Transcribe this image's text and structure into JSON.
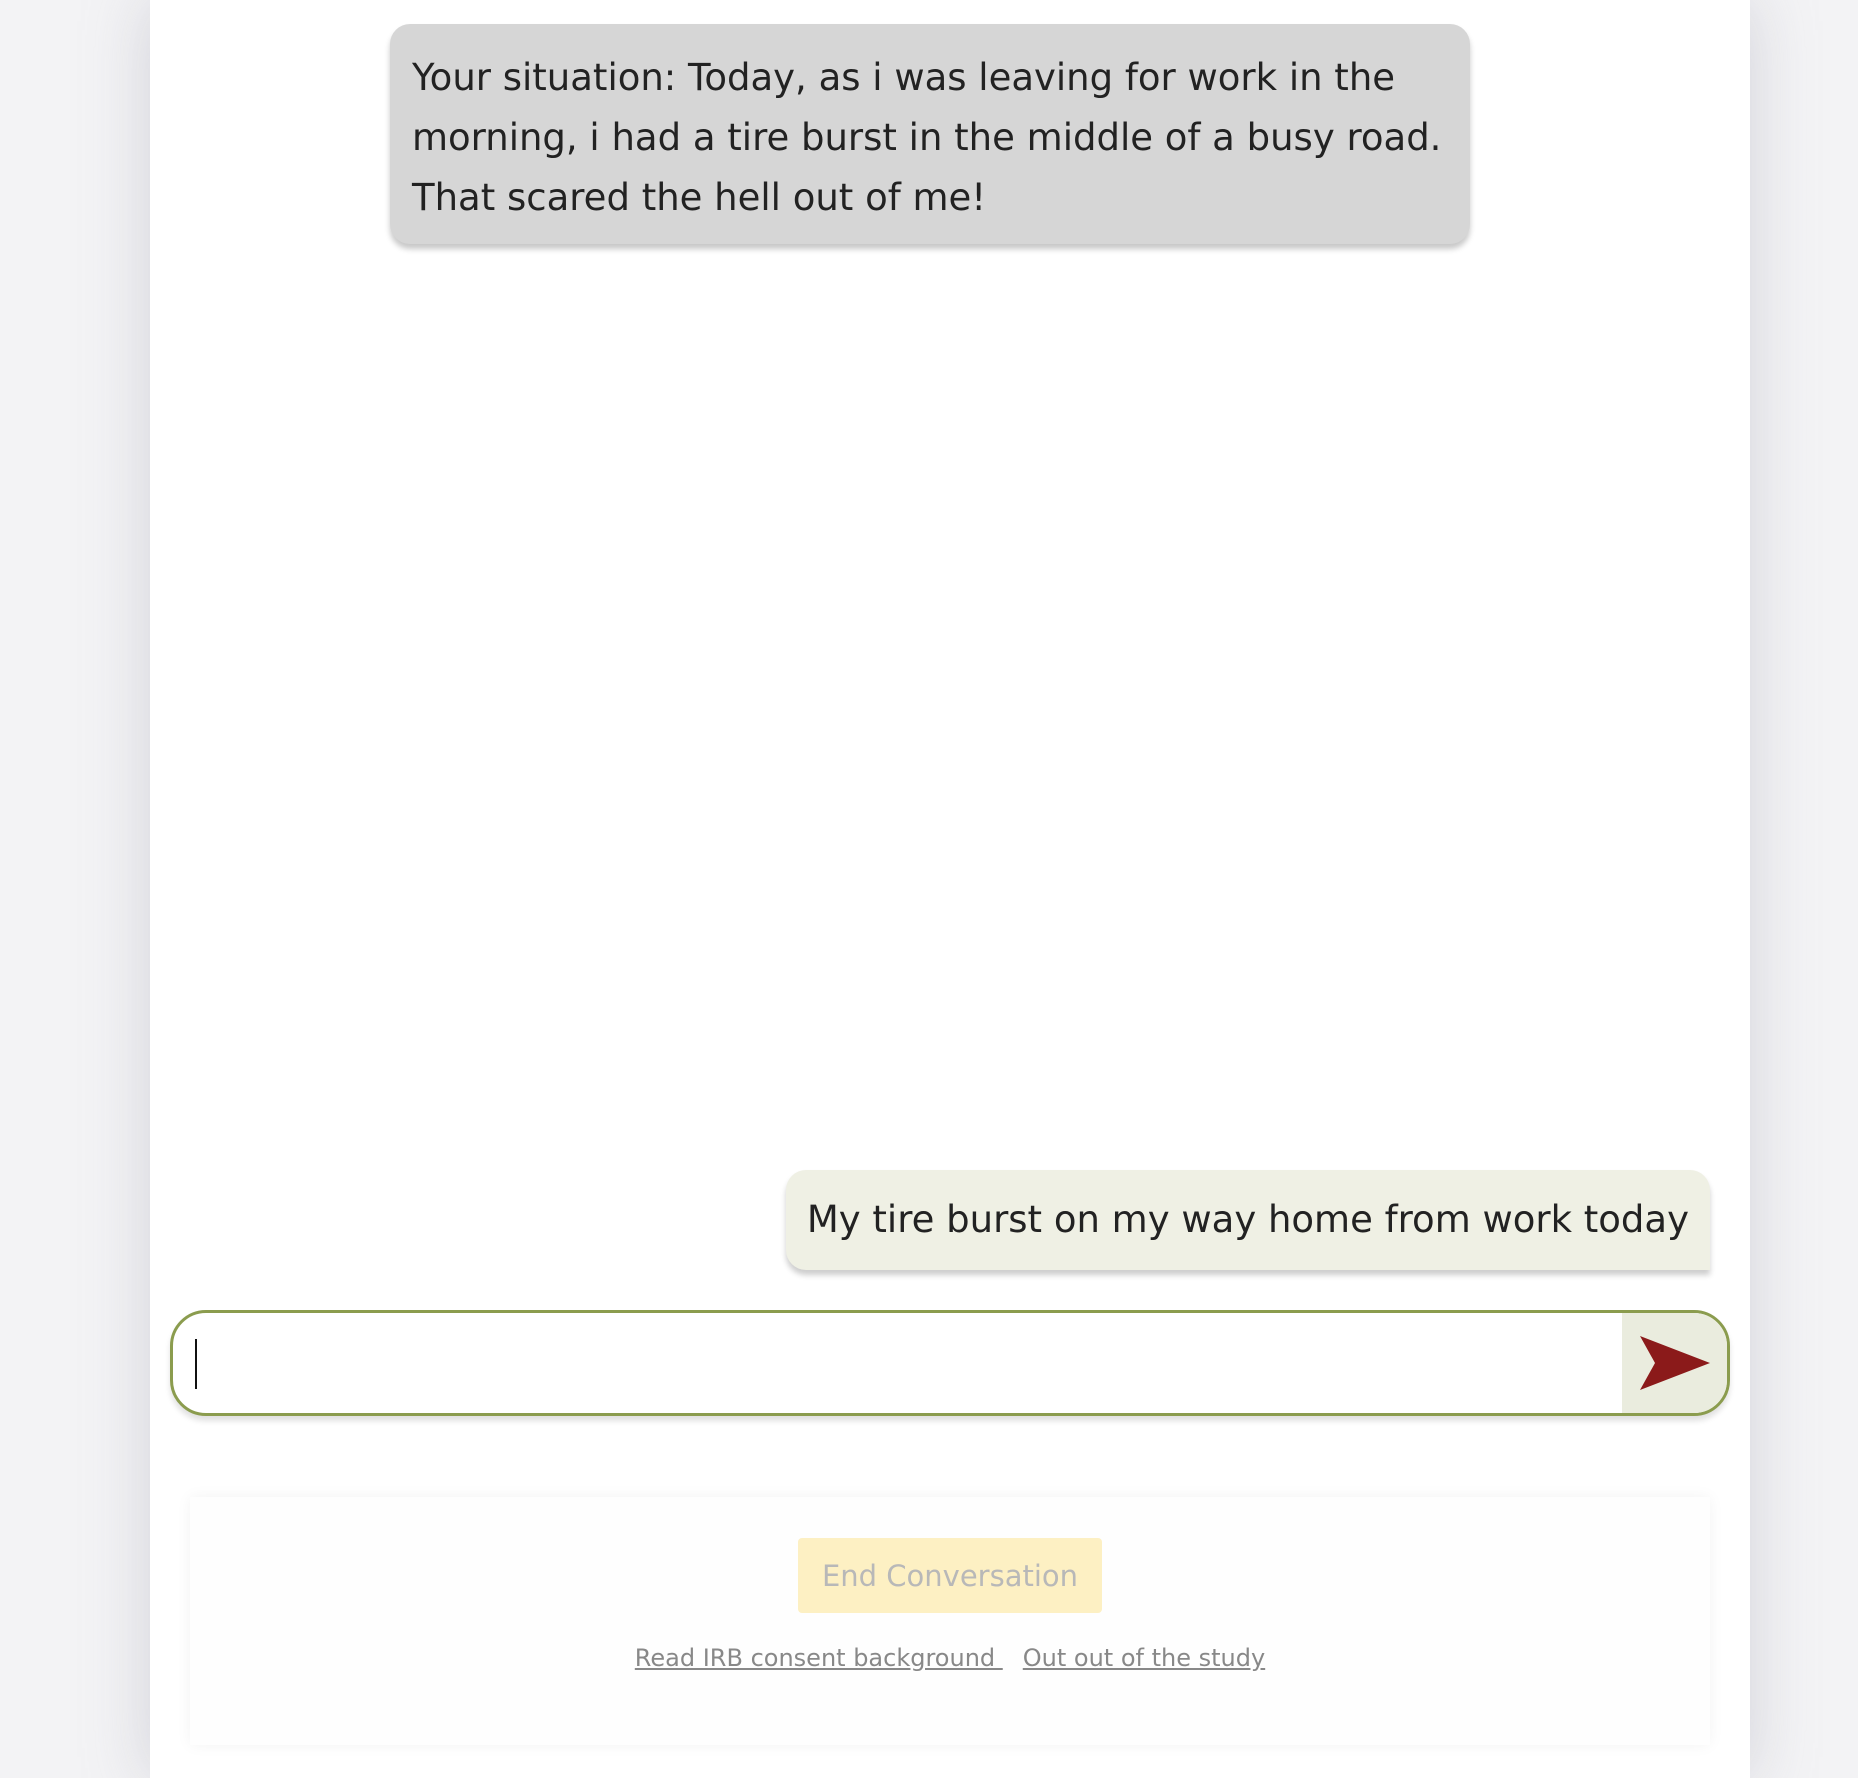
{
  "conversation": {
    "situation_text": "Your situation: Today, as i was leaving for work in the morning, i had a tire burst in the middle of a busy road. That scared the hell out of me!",
    "user_message": "My tire burst on my way home from work today"
  },
  "composer": {
    "input_value": "",
    "placeholder": "",
    "send_icon": "send-arrow-icon",
    "border_color": "#8b9c4e",
    "send_icon_color": "#8b1a1a"
  },
  "footer": {
    "end_button_label": "End Conversation",
    "end_button_color": "#fdf0c3",
    "links": [
      {
        "label": "Read IRB consent background "
      },
      {
        "label": "Out out of the study"
      }
    ]
  }
}
